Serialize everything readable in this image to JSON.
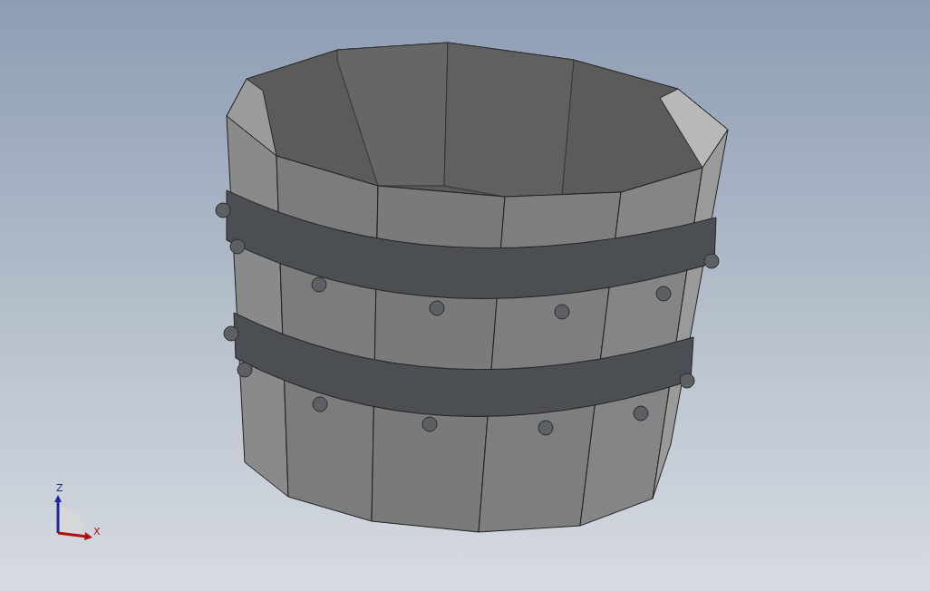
{
  "triad": {
    "axes": [
      {
        "kind": "z",
        "label": "Z"
      },
      {
        "kind": "x",
        "label": "X"
      }
    ]
  }
}
